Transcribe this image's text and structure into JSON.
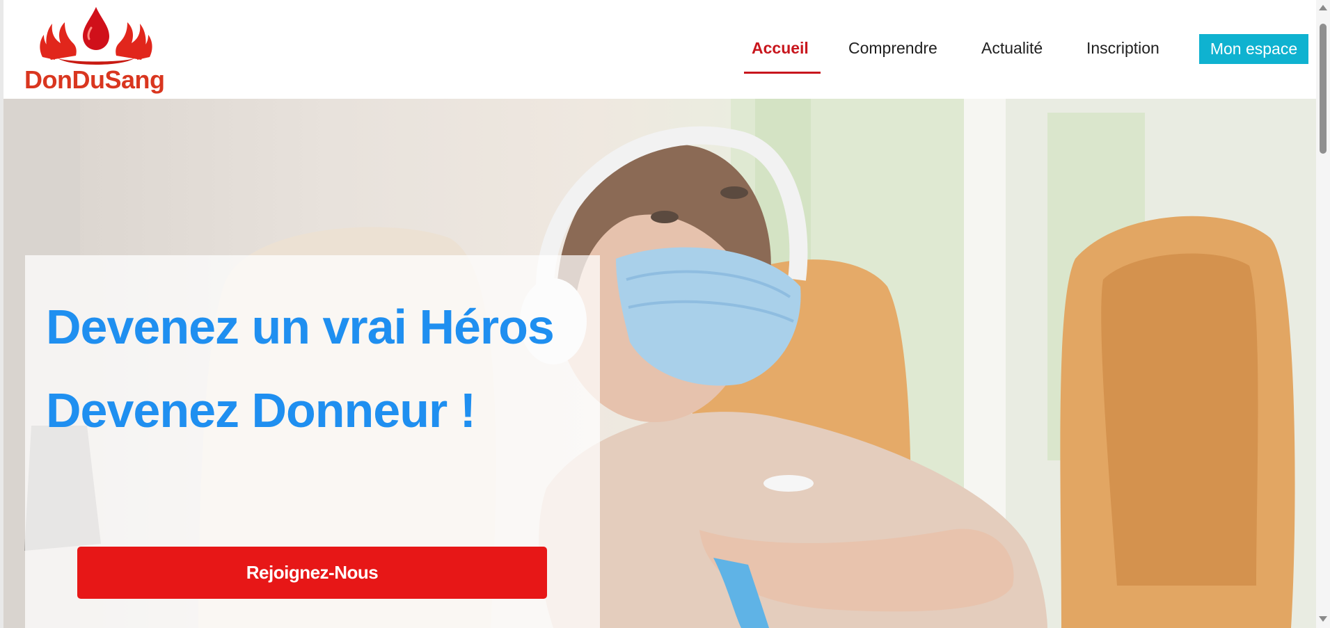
{
  "brand": {
    "name": "DonDuSang",
    "color": "#d9361f"
  },
  "nav": {
    "items": [
      {
        "label": "Accueil",
        "active": true
      },
      {
        "label": "Comprendre",
        "active": false
      },
      {
        "label": "Actualité",
        "active": false
      },
      {
        "label": "Inscription",
        "active": false
      }
    ],
    "account_button": "Mon espace"
  },
  "hero": {
    "headline_line1": "Devenez un vrai Héros",
    "headline_line2": "Devenez Donneur !",
    "cta_label": "Rejoignez-Nous",
    "headline_color": "#1f8ff0",
    "cta_color": "#e71717"
  },
  "colors": {
    "accent_red": "#c8161d",
    "account_button_bg": "#0fb2d0"
  }
}
